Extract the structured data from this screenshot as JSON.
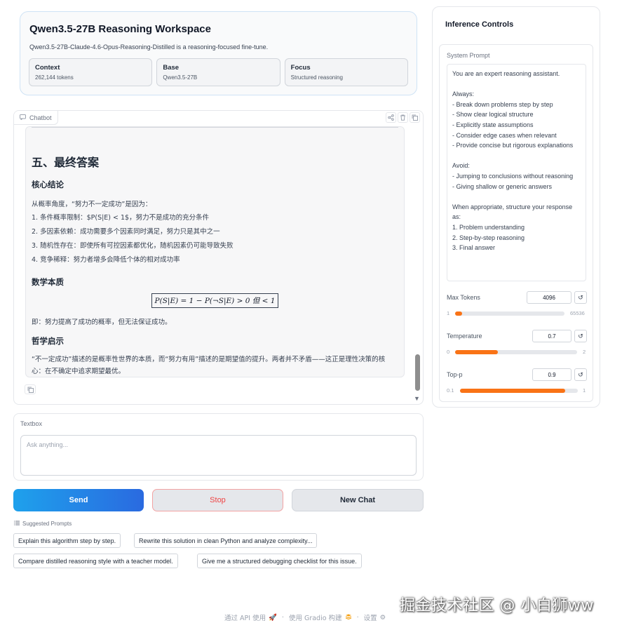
{
  "header": {
    "title": "Qwen3.5-27B Reasoning Workspace",
    "subtitle": "Qwen3.5-27B-Claude-4.6-Opus-Reasoning-Distilled is a reasoning-focused fine-tune.",
    "cards": [
      {
        "label": "Context",
        "value": "262,144 tokens"
      },
      {
        "label": "Base",
        "value": "Qwen3.5-27B"
      },
      {
        "label": "Focus",
        "value": "Structured reasoning"
      }
    ]
  },
  "chatbot": {
    "label": "Chatbot",
    "message": {
      "h2": "五、最终答案",
      "h3_conclusion": "核心结论",
      "intro": "从概率角度，“努力不一定成功”是因为：",
      "points": [
        "1. 条件概率限制：$P(S|E) < 1$，努力不是成功的充分条件",
        "2. 多因素依赖：成功需要多个因素同时满足，努力只是其中之一",
        "3. 随机性存在：即使所有可控因素都优化，随机因素仍可能导致失败",
        "4. 竞争稀释：努力者增多会降低个体的相对成功率"
      ],
      "h3_math": "数学本质",
      "formula": "P(S|E) = 1 − P(¬S|E) > 0 但 < 1",
      "summary": "即：努力提高了成功的概率，但无法保证成功。",
      "h3_philosophy": "哲学启示",
      "philosophy": "“不一定成功”描述的是概率性世界的本质，而“努力有用”描述的是期望值的提升。两者并不矛盾——这正是理性决策的核心：在不确定中追求期望最优。"
    }
  },
  "textbox": {
    "label": "Textbox",
    "placeholder": "Ask anything..."
  },
  "buttons": {
    "send": "Send",
    "stop": "Stop",
    "new_chat": "New Chat"
  },
  "suggested": {
    "label": "Suggested Prompts",
    "prompts": [
      "Explain this algorithm step by step.",
      "Rewrite this solution in clean Python and analyze complexity...",
      "Compare distilled reasoning style with a teacher model.",
      "Give me a structured debugging checklist for this issue."
    ]
  },
  "footer": {
    "api": "通过 API 使用",
    "built": "使用 Gradio 构建",
    "settings": "设置",
    "watermark": "掘金技术社区 @ 小白狮ww"
  },
  "controls": {
    "title": "Inference Controls",
    "system_prompt_label": "System Prompt",
    "system_prompt": "You are an expert reasoning assistant.\n\nAlways:\n- Break down problems step by step\n- Show clear logical structure\n- Explicitly state assumptions\n- Consider edge cases when relevant\n- Provide concise but rigorous explanations\n\nAvoid:\n- Jumping to conclusions without reasoning\n- Giving shallow or generic answers\n\nWhen appropriate, structure your response as:\n1. Problem understanding\n2. Step-by-step reasoning\n3. Final answer",
    "max_tokens": {
      "label": "Max Tokens",
      "value": "4096",
      "min": "1",
      "max": "65536",
      "fraction": 0.0625
    },
    "temperature": {
      "label": "Temperature",
      "value": "0.7",
      "min": "0",
      "max": "2",
      "fraction": 0.35
    },
    "top_p": {
      "label": "Top-p",
      "value": "0.9",
      "min": "0.1",
      "max": "1",
      "fraction": 0.89
    }
  },
  "icons": {
    "chat": "chat-bubble-icon",
    "share": "share-icon",
    "trash": "trash-icon",
    "copy": "copy-icon",
    "reset": "reset-icon",
    "list": "list-icon",
    "rocket": "rocket-icon",
    "gear": "gear-icon"
  },
  "colors": {
    "accent": "#f97316",
    "send_start": "#1ea1ec",
    "send_end": "#2a6ae0",
    "stop_text": "#ef4444"
  }
}
